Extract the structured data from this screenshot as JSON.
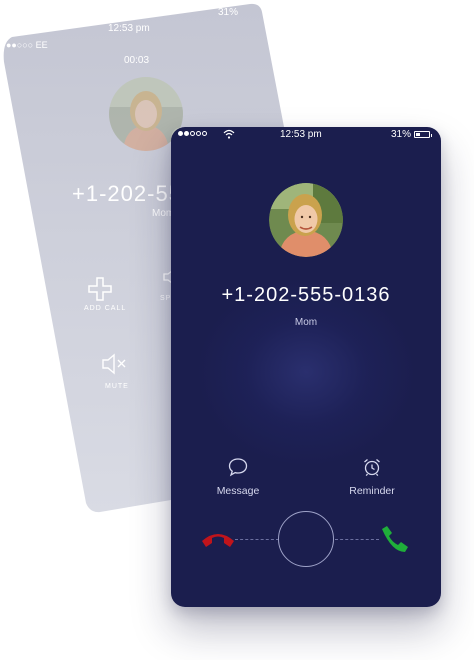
{
  "colors": {
    "front_background": "#1b1e4e",
    "back_background": "#c7c9d6",
    "decline": "#c0141b",
    "accept": "#1fae3a",
    "text": "#ffffff"
  },
  "back_screen": {
    "carrier": "●●○○○ EE",
    "time": "12:53 pm",
    "battery": "31%",
    "call_timer": "00:03",
    "caller_number": "+1-202-555",
    "caller_name": "Mom",
    "actions": [
      {
        "label": "ADD CALL",
        "icon": "plus-icon"
      },
      {
        "label": "SP",
        "icon": "speaker-icon"
      },
      {
        "label": "MUTE",
        "icon": "mute-icon"
      }
    ]
  },
  "front_screen": {
    "status_bar": {
      "time": "12:53 pm",
      "battery_text": "31%",
      "battery_level": 0.31,
      "signal_bars_filled": 2,
      "signal_bars_total": 5
    },
    "caller": {
      "number": "+1-202-555-0136",
      "name": "Mom"
    },
    "actions": {
      "message": {
        "label": "Message",
        "icon": "chat-bubble-icon"
      },
      "reminder": {
        "label": "Reminder",
        "icon": "alarm-clock-icon"
      }
    },
    "controls": {
      "decline_icon": "phone-hangup-icon",
      "accept_icon": "phone-icon"
    }
  }
}
